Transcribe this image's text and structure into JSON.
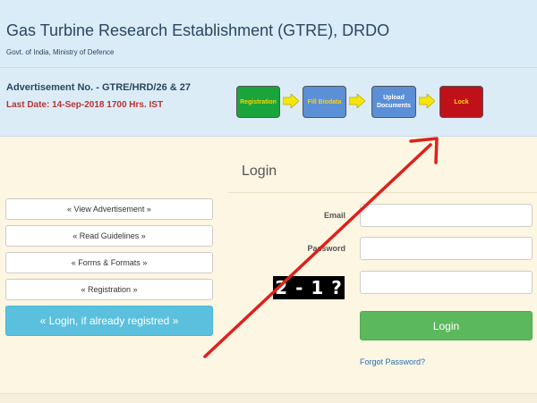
{
  "header": {
    "title": "Gas Turbine Research Establishment (GTRE), DRDO",
    "subtitle": "Govt. of India, Ministry of Defence"
  },
  "advertisement": {
    "number": "Advertisement No. - GTRE/HRD/26 & 27",
    "last_date": "Last Date: 14-Sep-2018 1700 Hrs. IST"
  },
  "steps": [
    {
      "label": "Registration",
      "color": "#1aa43c"
    },
    {
      "label": "Fill Biodata",
      "color": "#5b8fd6"
    },
    {
      "label": "Upload Documents",
      "color": "#5b8fd6"
    },
    {
      "label": "Lock",
      "color": "#c0111a"
    }
  ],
  "colors": {
    "step_text_light": "#ffffff",
    "step_text_dark": "#ffd400",
    "arrow": "#f5e60a",
    "annotation": "#e0201b"
  },
  "sidebar": {
    "items": [
      {
        "label": "« View Advertisement »"
      },
      {
        "label": "« Read Guidelines »"
      },
      {
        "label": "« Forms & Formats »"
      },
      {
        "label": "« Registration »"
      }
    ],
    "login_label": "« Login, if already registred »"
  },
  "login": {
    "title": "Login",
    "email_label": "Email",
    "email_value": "",
    "password_label": "Password",
    "password_value": "",
    "captcha_text": "2 - 1 ?",
    "captcha_value": "",
    "button_label": "Login",
    "forgot_label": "Forgot Password?"
  }
}
